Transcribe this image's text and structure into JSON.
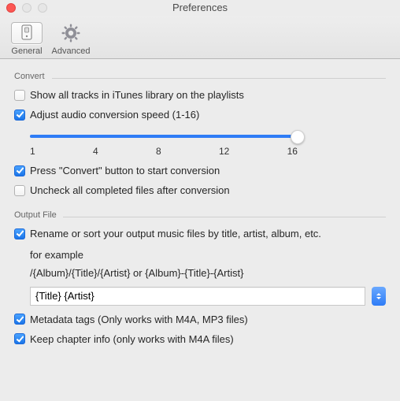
{
  "window": {
    "title": "Preferences"
  },
  "toolbar": {
    "tabs": [
      {
        "label": "General",
        "selected": true
      },
      {
        "label": "Advanced",
        "selected": false
      }
    ]
  },
  "convert": {
    "title": "Convert",
    "show_all_tracks": {
      "label": "Show all tracks in iTunes library on the playlists",
      "checked": false
    },
    "adjust_speed": {
      "label": "Adjust audio conversion speed (1-16)",
      "checked": true,
      "min": 1,
      "max": 16,
      "value": 16,
      "ticks": [
        "1",
        "4",
        "8",
        "12",
        "16"
      ]
    },
    "press_convert": {
      "label": "Press \"Convert\" button to start conversion",
      "checked": true
    },
    "uncheck_completed": {
      "label": "Uncheck all completed files after conversion",
      "checked": false
    }
  },
  "output": {
    "title": "Output File",
    "rename": {
      "label": "Rename or sort your output music files by title, artist, album, etc.",
      "checked": true,
      "example_line1": "for example",
      "example_line2": "/{Album}/{Title}/{Artist} or {Album}-{Title}-{Artist}",
      "pattern_value": "{Title} {Artist}"
    },
    "metadata": {
      "label": "Metadata tags (Only works with M4A, MP3 files)",
      "checked": true
    },
    "chapter": {
      "label": "Keep chapter info (only works with  M4A files)",
      "checked": true
    }
  },
  "chart_data": {
    "type": "table",
    "title": "Preferences checkbox states",
    "categories": [
      "Show all tracks in iTunes library on the playlists",
      "Adjust audio conversion speed (1-16)",
      "Press \"Convert\" button to start conversion",
      "Uncheck all completed files after conversion",
      "Rename or sort your output music files by title, artist, album, etc.",
      "Metadata tags (Only works with M4A, MP3 files)",
      "Keep chapter info (only works with  M4A files)"
    ],
    "values": [
      false,
      true,
      true,
      false,
      true,
      true,
      true
    ]
  }
}
